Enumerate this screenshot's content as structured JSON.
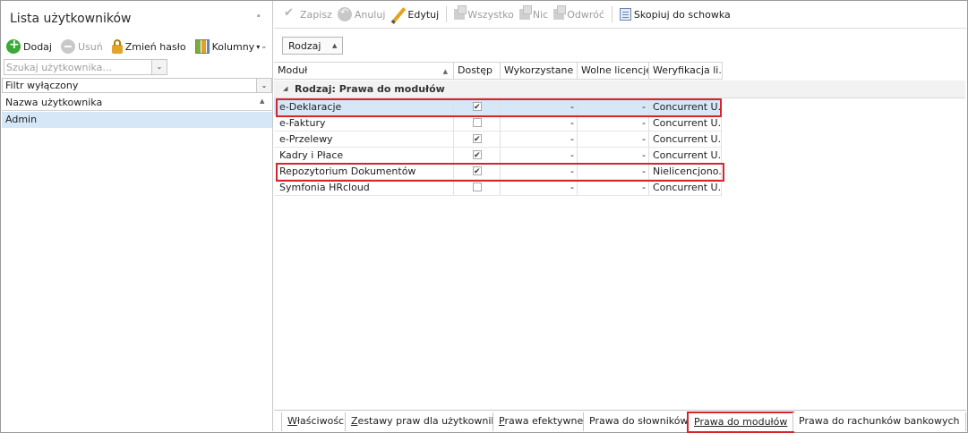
{
  "left_panel": {
    "title": "Lista użytkowników",
    "pin_icon": "pin-icon",
    "toolbar": {
      "add_label": "Dodaj",
      "delete_label": "Usuń",
      "change_password_label": "Zmień hasło",
      "columns_label": "Kolumny"
    },
    "search": {
      "placeholder": "Szukaj użytkownika..."
    },
    "filter": {
      "value": "Filtr wyłączony"
    },
    "column_header": "Nazwa użytkownika",
    "users": [
      "Admin"
    ]
  },
  "toolbar": {
    "save_label": "Zapisz",
    "cancel_label": "Anuluj",
    "edit_label": "Edytuj",
    "all_label": "Wszystko",
    "none_label": "Nic",
    "invert_label": "Odwróć",
    "copy_label": "Skopiuj do schowka"
  },
  "grouping": {
    "chip_label": "Rodzaj"
  },
  "grid": {
    "columns": [
      "Moduł",
      "Dostęp",
      "Wykorzystane ...",
      "Wolne licencje",
      "Weryfikacja li..."
    ],
    "group_label": "Rodzaj: Prawa do modułów",
    "rows": [
      {
        "module": "e-Deklaracje",
        "access": true,
        "used": "-",
        "free": "-",
        "verification": "Concurrent U..."
      },
      {
        "module": "e-Faktury",
        "access": false,
        "used": "-",
        "free": "-",
        "verification": "Concurrent U..."
      },
      {
        "module": "e-Przelewy",
        "access": true,
        "used": "-",
        "free": "-",
        "verification": "Concurrent U..."
      },
      {
        "module": "Kadry i Płace",
        "access": true,
        "used": "-",
        "free": "-",
        "verification": "Concurrent U..."
      },
      {
        "module": "Repozytorium Dokumentów",
        "access": true,
        "used": "-",
        "free": "-",
        "verification": "Nielicencjono..."
      },
      {
        "module": "Symfonia HRcloud",
        "access": false,
        "used": "-",
        "free": "-",
        "verification": "Concurrent U..."
      }
    ]
  },
  "tabs": [
    {
      "label_u": "W",
      "label_rest": "łaściwości"
    },
    {
      "label_u": "Z",
      "label_rest": "estawy praw dla użytkownika"
    },
    {
      "label_u": "P",
      "label_rest": "rawa efektywne"
    },
    {
      "label_u": "",
      "label_rest": "Prawa do słowników"
    },
    {
      "label_u": "P",
      "label_rest": "rawa do modułów"
    },
    {
      "label_u": "",
      "label_rest": "Prawa do rachunków bankowych"
    }
  ],
  "colors": {
    "selection": "#d6e8f8",
    "highlight": "#d6262b",
    "add_green": "#3aa935"
  }
}
